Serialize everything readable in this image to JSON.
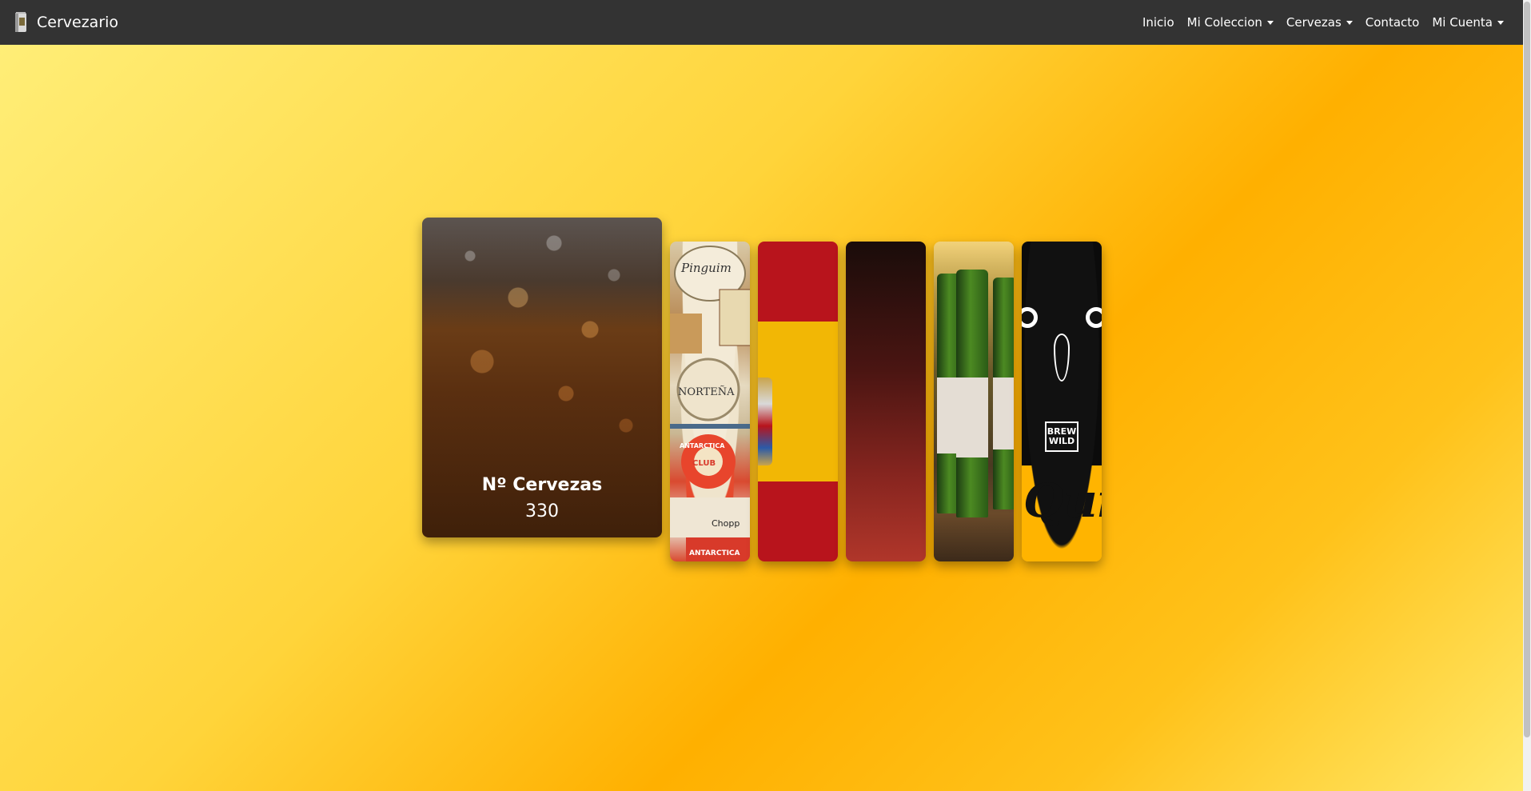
{
  "navbar": {
    "brand": "Cervezario",
    "links": [
      {
        "label": "Inicio",
        "dropdown": false
      },
      {
        "label": "Mi Coleccion",
        "dropdown": true
      },
      {
        "label": "Cervezas",
        "dropdown": true
      },
      {
        "label": "Contacto",
        "dropdown": false
      },
      {
        "label": "Mi Cuenta",
        "dropdown": true
      }
    ]
  },
  "main_card": {
    "title": "Nº Cervezas",
    "value": "330"
  },
  "strip_cards": [
    {
      "name": "coasters",
      "text_lines": [
        "Pinguim",
        "NORTEÑA",
        "ANTARCTICA",
        "CLUB SODA",
        "Chopp",
        "ANTARCTICA"
      ]
    },
    {
      "name": "spain-flag"
    },
    {
      "name": "dark-red"
    },
    {
      "name": "green-bottles"
    },
    {
      "name": "brew-wild-owl",
      "badge_top": "BREW",
      "badge_bottom": "WILD",
      "script": "Quin"
    }
  ]
}
